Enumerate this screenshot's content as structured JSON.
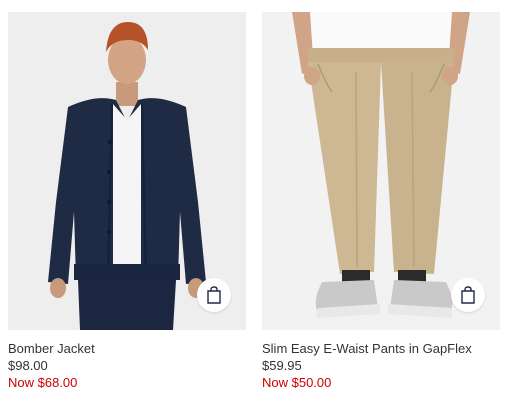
{
  "products": [
    {
      "name": "Bomber Jacket",
      "price": "$98.00",
      "sale_price": "Now $68.00",
      "image_alt": "Bomber Jacket",
      "bag_icon": "shopping-bag-icon"
    },
    {
      "name": "Slim Easy E-Waist Pants in GapFlex",
      "price": "$59.95",
      "sale_price": "Now $50.00",
      "image_alt": "Slim Easy E-Waist Pants in GapFlex",
      "bag_icon": "shopping-bag-icon"
    }
  ],
  "colors": {
    "sale": "#d00000",
    "text": "#333333",
    "image_bg": "#eeeeee",
    "bag_icon": "#1f2a4a"
  }
}
